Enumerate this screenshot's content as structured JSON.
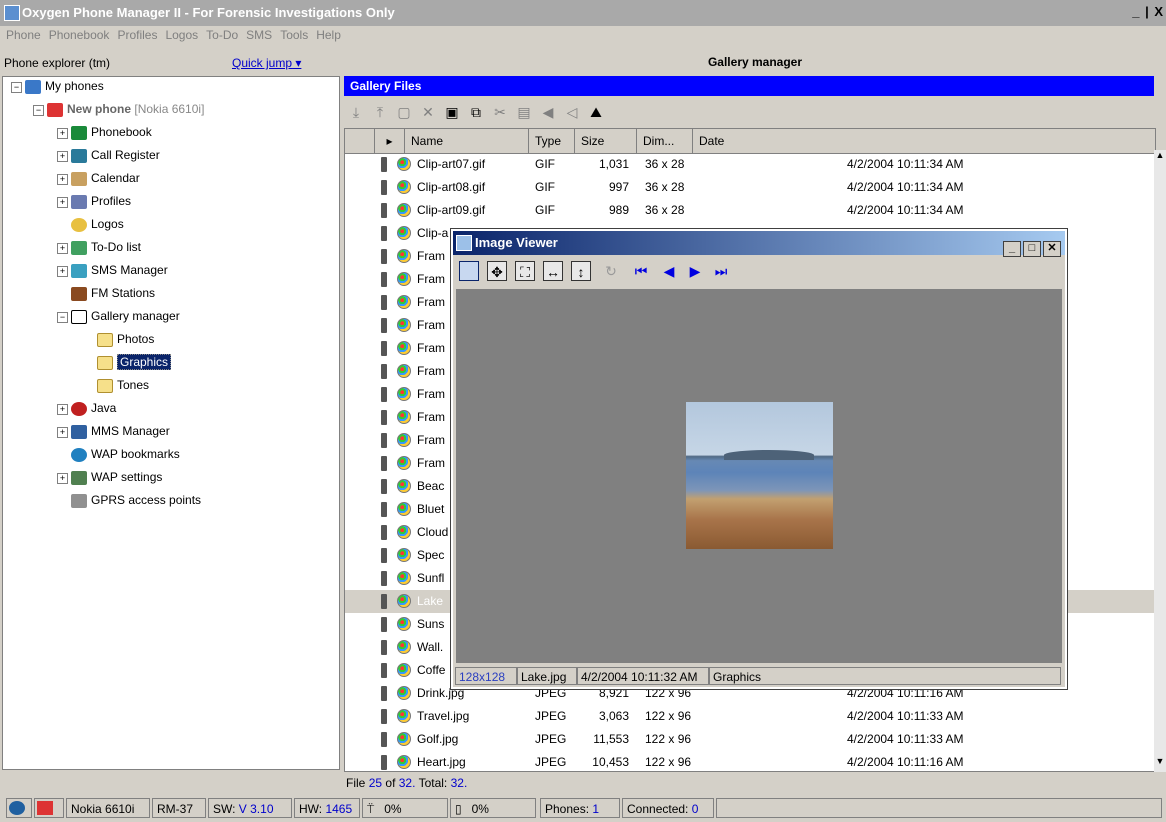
{
  "app": {
    "title": "Oxygen Phone Manager II - For Forensic Investigations Only",
    "window_buttons": "_ | X"
  },
  "menu": [
    "Phone",
    "Phonebook",
    "Profiles",
    "Logos",
    "To-Do",
    "SMS",
    "Tools",
    "Help"
  ],
  "left_panel": {
    "title": "Phone explorer (tm)",
    "quick_jump": "Quick jump",
    "tree": {
      "root": "My phones",
      "phone_name": "New phone",
      "phone_model": "[Nokia 6610i]",
      "items": [
        "Phonebook",
        "Call Register",
        "Calendar",
        "Profiles",
        "Logos",
        "To-Do list",
        "SMS Manager",
        "FM Stations",
        "Gallery manager"
      ],
      "gallery_children": [
        "Photos",
        "Graphics",
        "Tones"
      ],
      "items_after": [
        "Java",
        "MMS Manager",
        "WAP bookmarks",
        "WAP settings",
        "GPRS access points"
      ]
    }
  },
  "right_panel": {
    "header": "Gallery manager",
    "section_title": "Gallery Files",
    "columns": [
      "Name",
      "Type",
      "Size",
      "Dim...",
      "Date"
    ],
    "rows": [
      {
        "name": "Clip-art07.gif",
        "type": "GIF",
        "size": "1,031",
        "dim": "36 x 28",
        "date": "4/2/2004 10:11:34 AM"
      },
      {
        "name": "Clip-art08.gif",
        "type": "GIF",
        "size": "997",
        "dim": "36 x 28",
        "date": "4/2/2004 10:11:34 AM"
      },
      {
        "name": "Clip-art09.gif",
        "type": "GIF",
        "size": "989",
        "dim": "36 x 28",
        "date": "4/2/2004 10:11:34 AM"
      },
      {
        "name": "Clip-a",
        "type": "",
        "size": "",
        "dim": "",
        "date": ""
      },
      {
        "name": "Fram",
        "type": "",
        "size": "",
        "dim": "",
        "date": ""
      },
      {
        "name": "Fram",
        "type": "",
        "size": "",
        "dim": "",
        "date": ""
      },
      {
        "name": "Fram",
        "type": "",
        "size": "",
        "dim": "",
        "date": ""
      },
      {
        "name": "Fram",
        "type": "",
        "size": "",
        "dim": "",
        "date": ""
      },
      {
        "name": "Fram",
        "type": "",
        "size": "",
        "dim": "",
        "date": ""
      },
      {
        "name": "Fram",
        "type": "",
        "size": "",
        "dim": "",
        "date": ""
      },
      {
        "name": "Fram",
        "type": "",
        "size": "",
        "dim": "",
        "date": ""
      },
      {
        "name": "Fram",
        "type": "",
        "size": "",
        "dim": "",
        "date": ""
      },
      {
        "name": "Fram",
        "type": "",
        "size": "",
        "dim": "",
        "date": ""
      },
      {
        "name": "Fram",
        "type": "",
        "size": "",
        "dim": "",
        "date": ""
      },
      {
        "name": "Beac",
        "type": "",
        "size": "",
        "dim": "",
        "date": ""
      },
      {
        "name": "Bluet",
        "type": "",
        "size": "",
        "dim": "",
        "date": ""
      },
      {
        "name": "Cloud",
        "type": "",
        "size": "",
        "dim": "",
        "date": ""
      },
      {
        "name": "Spec",
        "type": "",
        "size": "",
        "dim": "",
        "date": ""
      },
      {
        "name": "Sunfl",
        "type": "",
        "size": "",
        "dim": "",
        "date": ""
      },
      {
        "name": "Lake",
        "type": "",
        "size": "",
        "dim": "",
        "date": "",
        "selected": true
      },
      {
        "name": "Suns",
        "type": "",
        "size": "",
        "dim": "",
        "date": ""
      },
      {
        "name": "Wall.",
        "type": "",
        "size": "",
        "dim": "",
        "date": ""
      },
      {
        "name": "Coffe",
        "type": "",
        "size": "",
        "dim": "",
        "date": ""
      },
      {
        "name": "Drink.jpg",
        "type": "JPEG",
        "size": "8,921",
        "dim": "122 x 96",
        "date": "4/2/2004 10:11:16 AM"
      },
      {
        "name": "Travel.jpg",
        "type": "JPEG",
        "size": "3,063",
        "dim": "122 x 96",
        "date": "4/2/2004 10:11:33 AM"
      },
      {
        "name": "Golf.jpg",
        "type": "JPEG",
        "size": "11,553",
        "dim": "122 x 96",
        "date": "4/2/2004 10:11:33 AM"
      },
      {
        "name": "Heart.jpg",
        "type": "JPEG",
        "size": "10,453",
        "dim": "122 x 96",
        "date": "4/2/2004 10:11:16 AM"
      }
    ],
    "status": {
      "prefix": "File",
      "current": "25",
      "mid": "of",
      "count": "32.",
      "total_label": "Total:",
      "total": "32."
    }
  },
  "viewer": {
    "title": "Image Viewer",
    "status": {
      "dims": "128x128",
      "file": "Lake.jpg",
      "date": "4/2/2004 10:11:32 AM",
      "folder": "Graphics"
    }
  },
  "bottom_bar": {
    "model": "Nokia 6610i",
    "code": "RM-37",
    "sw_label": "SW:",
    "sw_value": "V 3.10",
    "hw_label": "HW:",
    "hw_value": "1465",
    "signal": "0%",
    "battery": "0%",
    "phones_label": "Phones:",
    "phones_value": "1",
    "connected_label": "Connected:",
    "connected_value": "0"
  }
}
